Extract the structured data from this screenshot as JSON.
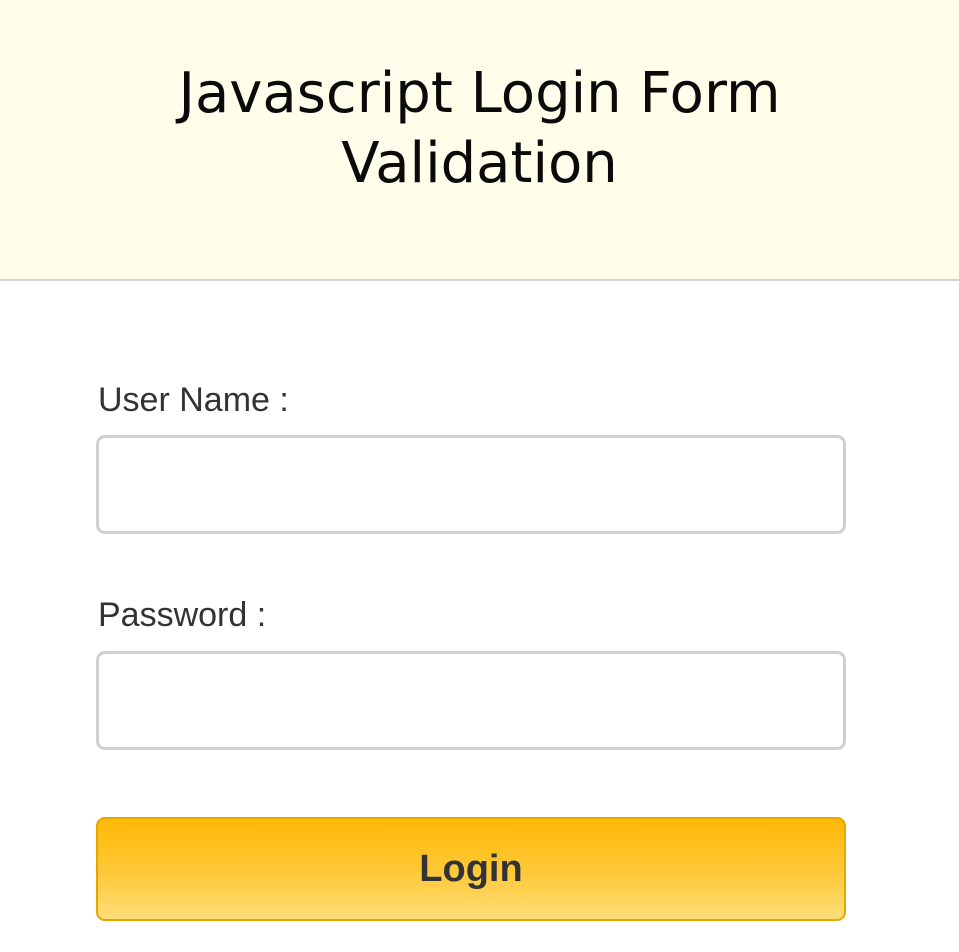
{
  "header": {
    "title": "Javascript Login Form Validation"
  },
  "form": {
    "username_label": "User Name :",
    "username_value": "",
    "password_label": "Password :",
    "password_value": "",
    "login_label": "Login"
  },
  "colors": {
    "header_bg": "#fefeeb",
    "button_top": "#ffb904",
    "button_bottom": "#ffde79",
    "input_border": "#cfcfcf"
  }
}
